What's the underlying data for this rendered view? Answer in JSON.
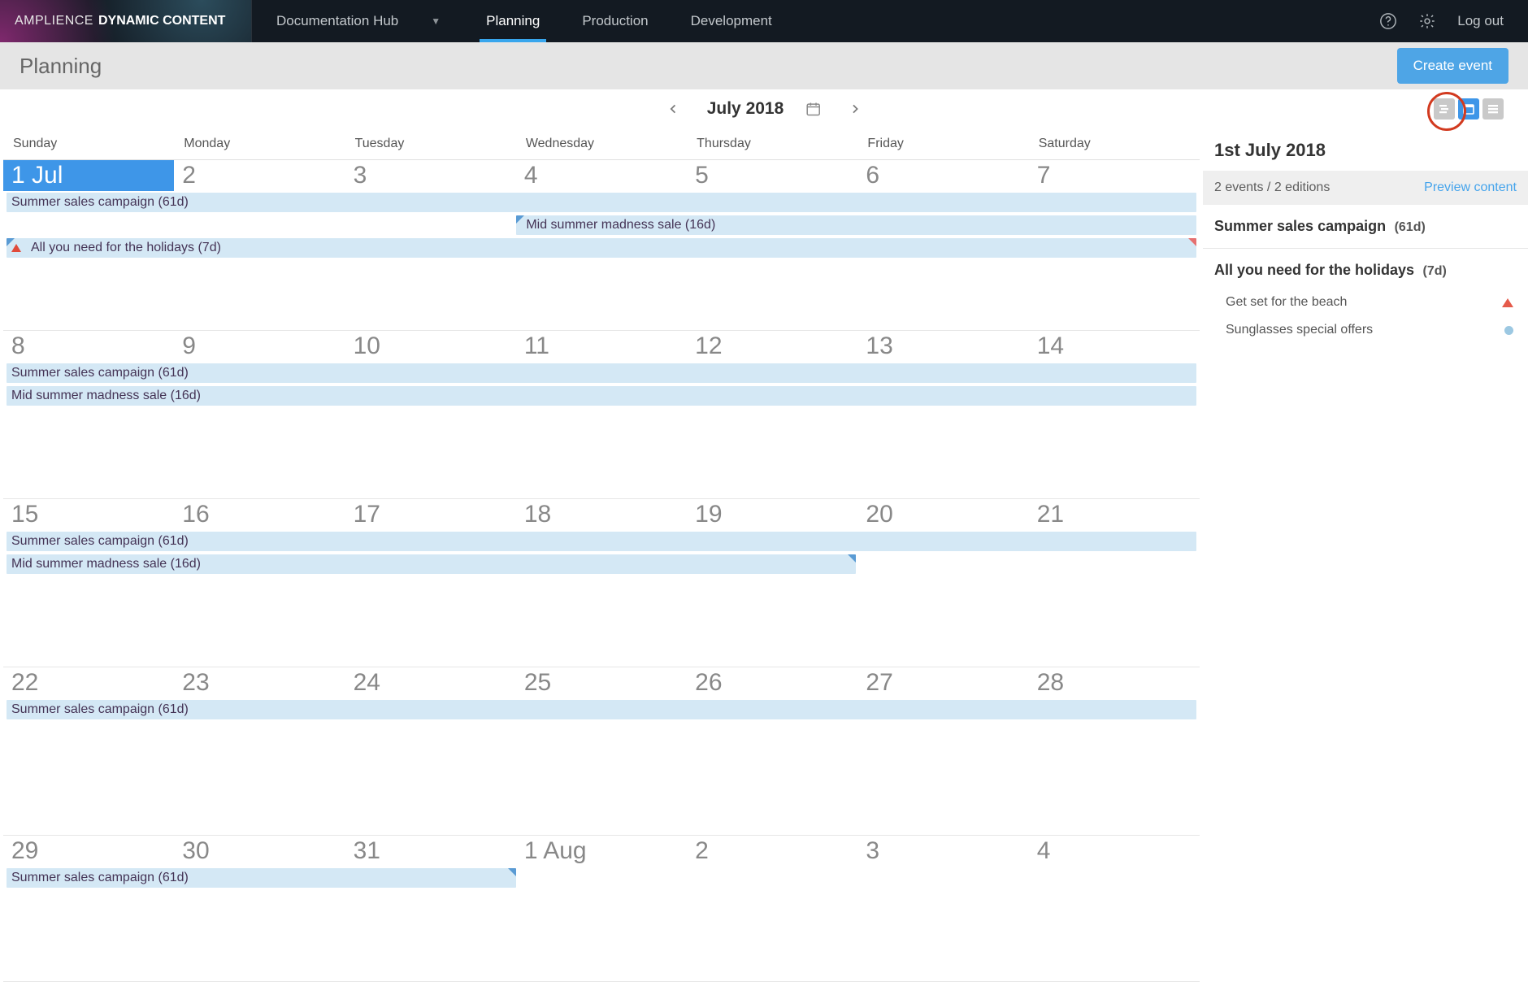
{
  "brand": {
    "thin": "AMPLIENCE",
    "bold": "DYNAMIC CONTENT"
  },
  "hub": {
    "label": "Documentation Hub"
  },
  "nav": {
    "planning": "Planning",
    "production": "Production",
    "development": "Development"
  },
  "top": {
    "logout": "Log out"
  },
  "page": {
    "title": "Planning"
  },
  "buttons": {
    "create_event": "Create event"
  },
  "month": {
    "label": "July 2018"
  },
  "dayHeaders": [
    "Sunday",
    "Monday",
    "Tuesday",
    "Wednesday",
    "Thursday",
    "Friday",
    "Saturday"
  ],
  "weeks": [
    {
      "nums": [
        "1 Jul",
        "2",
        "3",
        "4",
        "5",
        "6",
        "7"
      ],
      "selectedIndex": 0
    },
    {
      "nums": [
        "8",
        "9",
        "10",
        "11",
        "12",
        "13",
        "14"
      ]
    },
    {
      "nums": [
        "15",
        "16",
        "17",
        "18",
        "19",
        "20",
        "21"
      ]
    },
    {
      "nums": [
        "22",
        "23",
        "24",
        "25",
        "26",
        "27",
        "28"
      ]
    },
    {
      "nums": [
        "29",
        "30",
        "31",
        "1 Aug",
        "2",
        "3",
        "4"
      ]
    }
  ],
  "eventsText": {
    "summer": "Summer sales campaign (61d)",
    "midsummer": "Mid summer madness sale (16d)",
    "holidays": "All you need for the holidays (7d)"
  },
  "side": {
    "date": "1st July 2018",
    "summary": "2 events / 2 editions",
    "preview": "Preview content",
    "events": [
      {
        "title": "Summer sales campaign",
        "duration": "(61d)"
      },
      {
        "title": "All you need for the holidays",
        "duration": "(7d)",
        "editions": [
          {
            "label": "Get set for the beach",
            "symbol": "tri"
          },
          {
            "label": "Sunglasses special offers",
            "symbol": "dot"
          }
        ]
      }
    ]
  }
}
